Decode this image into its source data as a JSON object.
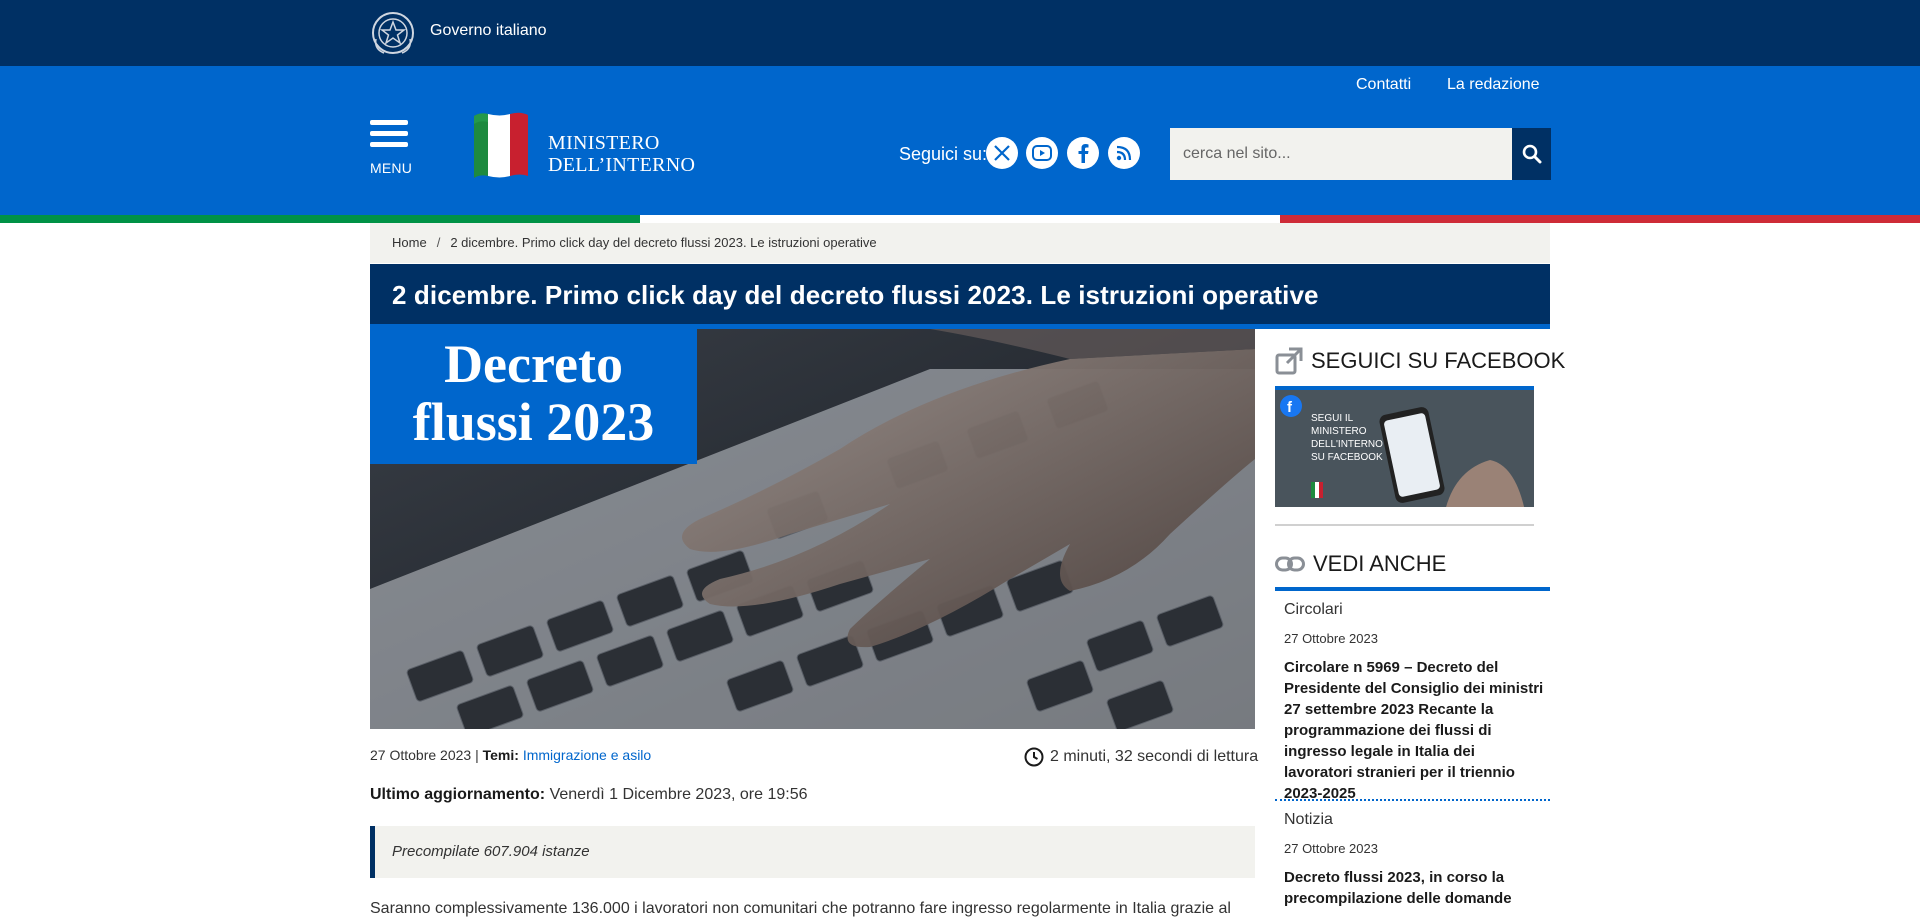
{
  "gov_bar": {
    "label": "Governo italiano"
  },
  "header": {
    "links": [
      "Contatti",
      "La redazione"
    ],
    "menu_label": "MENU",
    "logo_line1": "MINISTERO",
    "logo_line2": "DELL’INTERNO",
    "follow_label": "Seguici su:",
    "social_icons": [
      "x-icon",
      "youtube-icon",
      "facebook-icon",
      "rss-icon"
    ],
    "search_placeholder": "cerca nel sito..."
  },
  "breadcrumb": {
    "home": "Home",
    "separator": "/",
    "current": "2 dicembre. Primo click day del decreto flussi 2023. Le istruzioni operative"
  },
  "article": {
    "title": "2 dicembre. Primo click day del decreto flussi 2023. Le istruzioni operative",
    "hero_line1": "Decreto",
    "hero_line2": "flussi 2023",
    "date": "27 Ottobre 2023",
    "pipe": "|",
    "themes_label": "Temi:",
    "themes_value": "Immigrazione e asilo",
    "read_time": "2 minuti, 32 secondi di lettura",
    "updated_label": "Ultimo aggiornamento:",
    "updated_value": "Venerdì 1 Dicembre 2023, ore 19:56",
    "abstract": "Precompilate 607.904 istanze",
    "body_start": "Saranno complessivamente 136.000 i lavoratori non comunitari che potranno fare ingresso regolarmente in Italia grazie al"
  },
  "sidebar": {
    "facebook_heading": "SEGUICI SU FACEBOOK",
    "facebook_card_text": [
      "SEGUI IL",
      "MINISTERO",
      "DELL'INTERNO",
      "SU FACEBOOK"
    ],
    "related_heading": "VEDI ANCHE",
    "related": [
      {
        "category": "Circolari",
        "date": "27 Ottobre 2023",
        "title": "Circolare n 5969 – Decreto del Presidente del Consiglio dei ministri 27 settembre 2023 Recante la programmazione dei flussi di ingresso legale in Italia dei lavoratori stranieri per il triennio 2023-2025"
      },
      {
        "category": "Notizia",
        "date": "27 Ottobre 2023",
        "title": "Decreto flussi 2023, in corso la precompilazione delle domande"
      }
    ]
  },
  "colors": {
    "navy": "#003064",
    "blue": "#0066cc",
    "green": "#009246",
    "red": "#ce2b37",
    "light_bg": "#f2f2ee"
  }
}
